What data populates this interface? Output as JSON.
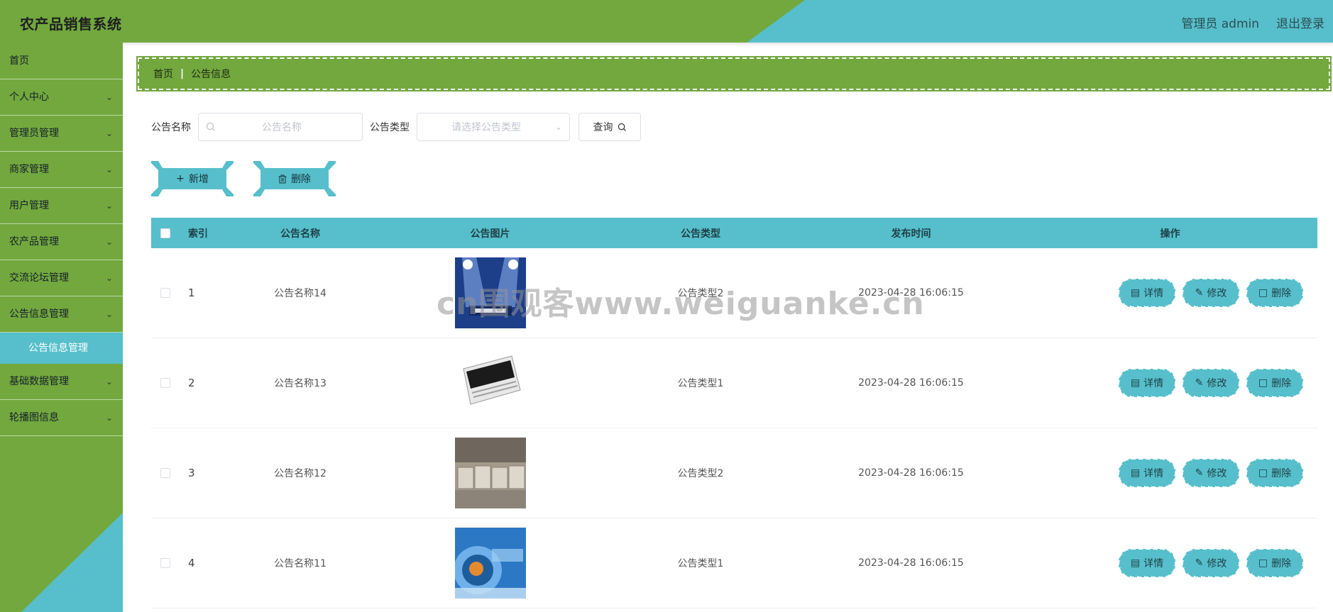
{
  "header": {
    "app_title": "农产品销售系统",
    "user_label": "管理员 admin",
    "logout_label": "退出登录"
  },
  "sidebar": {
    "home": "首页",
    "items": [
      {
        "label": "个人中心",
        "icon": "chevron-down-icon"
      },
      {
        "label": "管理员管理",
        "icon": "chevron-down-icon"
      },
      {
        "label": "商家管理",
        "icon": "chevron-down-icon"
      },
      {
        "label": "用户管理",
        "icon": "chevron-down-icon"
      },
      {
        "label": "农产品管理",
        "icon": "chevron-down-icon"
      },
      {
        "label": "交流论坛管理",
        "icon": "chevron-down-icon"
      },
      {
        "label": "公告信息管理",
        "icon": "chevron-down-icon"
      },
      {
        "label": "基础数据管理",
        "icon": "chevron-down-icon"
      },
      {
        "label": "轮播图信息",
        "icon": "chevron-down-icon"
      }
    ],
    "active_sub": "公告信息管理"
  },
  "breadcrumb": {
    "home": "首页",
    "current": "公告信息"
  },
  "search": {
    "name_label": "公告名称",
    "name_placeholder": "公告名称",
    "type_label": "公告类型",
    "type_placeholder": "请选择公告类型",
    "query_label": "查询"
  },
  "actions": {
    "add_label": "新增",
    "delete_label": "删除"
  },
  "table": {
    "headers": {
      "index": "索引",
      "name": "公告名称",
      "image": "公告图片",
      "type": "公告类型",
      "time": "发布时间",
      "ops": "操作"
    },
    "rows": [
      {
        "index": "1",
        "name": "公告名称14",
        "image": "news-spotlight-image",
        "type": "公告类型2",
        "time": "2023-04-28 16:06:15"
      },
      {
        "index": "2",
        "name": "公告名称13",
        "image": "newspaper-image",
        "type": "公告类型1",
        "time": "2023-04-28 16:06:15"
      },
      {
        "index": "3",
        "name": "公告名称12",
        "image": "news-cubes-image",
        "type": "公告类型2",
        "time": "2023-04-28 16:06:15"
      },
      {
        "index": "4",
        "name": "公告名称11",
        "image": "news-globe-image",
        "type": "公告类型1",
        "time": "2023-04-28 16:06:15"
      }
    ],
    "ops": {
      "detail": "详情",
      "edit": "修改",
      "delete": "删除"
    }
  },
  "watermark": "cn围观客www.weiguanke.cn",
  "colors": {
    "green": "#72a83e",
    "teal": "#56bfcb"
  }
}
